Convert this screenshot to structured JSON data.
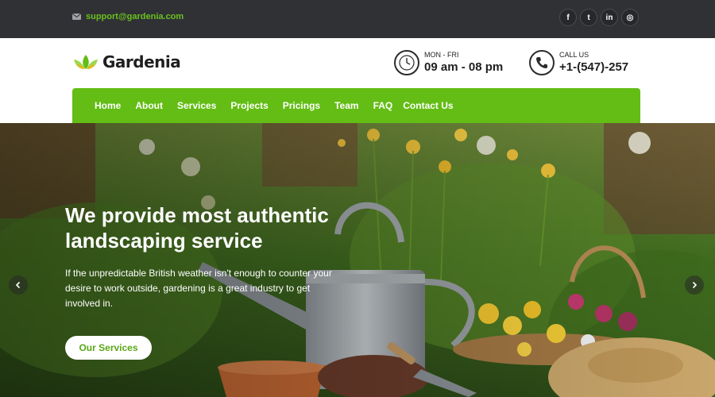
{
  "topbar": {
    "email": "support@gardenia.com",
    "socials": [
      {
        "icon": "facebook-icon",
        "glyph": "f"
      },
      {
        "icon": "twitter-icon",
        "glyph": "t"
      },
      {
        "icon": "linkedin-icon",
        "glyph": "in"
      },
      {
        "icon": "instagram-icon",
        "glyph": "◎"
      }
    ]
  },
  "header": {
    "brand": "Gardenia",
    "hours": {
      "label": "MON - FRI",
      "value": "09 am - 08 pm"
    },
    "call": {
      "label": "CALL US",
      "value": "+1-(547)-257"
    }
  },
  "nav": {
    "items": [
      "Home",
      "About",
      "Services",
      "Projects",
      "Pricings",
      "Team",
      "FAQ",
      "Contact Us"
    ]
  },
  "hero": {
    "title": "We provide most authentic landscaping service",
    "description": "If the unpredictable British weather isn't enough to counter your desire to work outside, gardening is a great industry to get involved in.",
    "cta_label": "Our Services",
    "prev_glyph": "‹",
    "next_glyph": "›"
  },
  "colors": {
    "accent": "#63bd14",
    "topbar_bg": "#2f3135",
    "email": "#6ac11e"
  }
}
